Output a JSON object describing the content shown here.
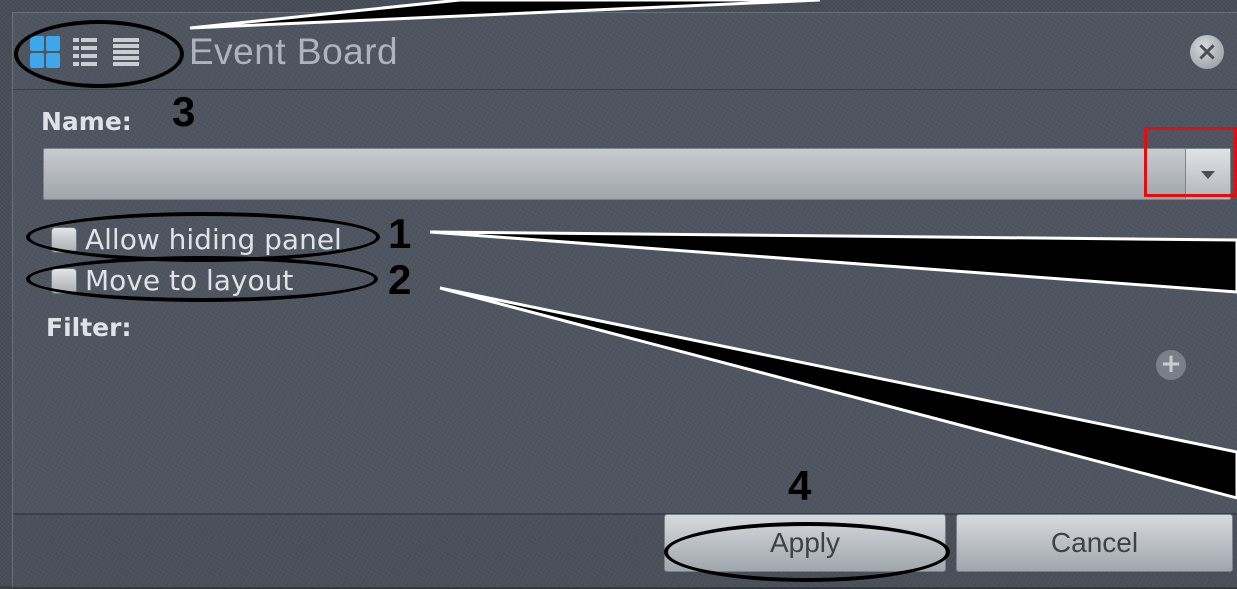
{
  "window": {
    "title": "Event Board",
    "close_icon": "×"
  },
  "view_modes": [
    {
      "name": "grid-view",
      "selected": true
    },
    {
      "name": "list-view",
      "selected": false
    },
    {
      "name": "detail-view",
      "selected": false
    }
  ],
  "form": {
    "name_label": "Name:",
    "name_value": "",
    "allow_hiding_label": "Allow hiding panel",
    "move_layout_label": "Move to layout",
    "filter_label": "Filter:",
    "add_symbol": "+"
  },
  "buttons": {
    "apply": "Apply",
    "cancel": "Cancel"
  },
  "annotations": {
    "n1": "1",
    "n2": "2",
    "n3": "3",
    "n4": "4"
  },
  "colors": {
    "accent": "#3ea6ea",
    "highlight_box": "#e01010",
    "annotation": "#000000"
  }
}
